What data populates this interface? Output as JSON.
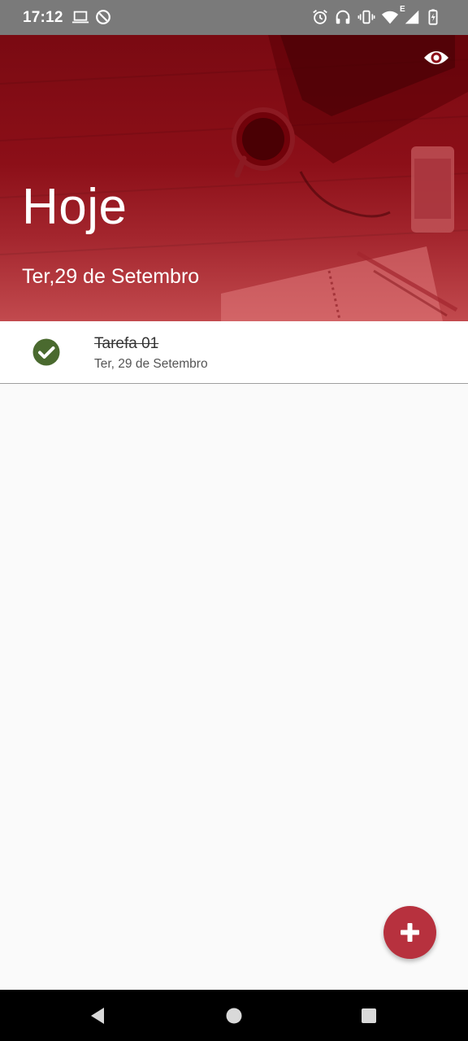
{
  "status_bar": {
    "time": "17:12",
    "network_label": "E",
    "icons": [
      "laptop-icon",
      "data-saver-icon",
      "alarm-icon",
      "headphones-icon",
      "vibrate-icon",
      "wifi-icon",
      "signal-icon",
      "battery-charging-icon"
    ]
  },
  "header": {
    "title": "Hoje",
    "date": "Ter,29 de Setembro",
    "toggle_icon": "eye-icon",
    "colors": {
      "overlay_top": "#7a0a12",
      "overlay_bottom": "#c24a4e"
    }
  },
  "tasks": [
    {
      "title": "Tarefa 01",
      "date": "Ter, 29 de Setembro",
      "done": true,
      "status_icon": "check-circle-icon"
    }
  ],
  "fab": {
    "icon": "plus-icon",
    "color": "#b7313e"
  },
  "nav_bar": {
    "buttons": [
      "back-icon",
      "home-icon",
      "recents-icon"
    ]
  },
  "colors": {
    "done_green": "#4a6a2f",
    "background": "#fafafa"
  }
}
